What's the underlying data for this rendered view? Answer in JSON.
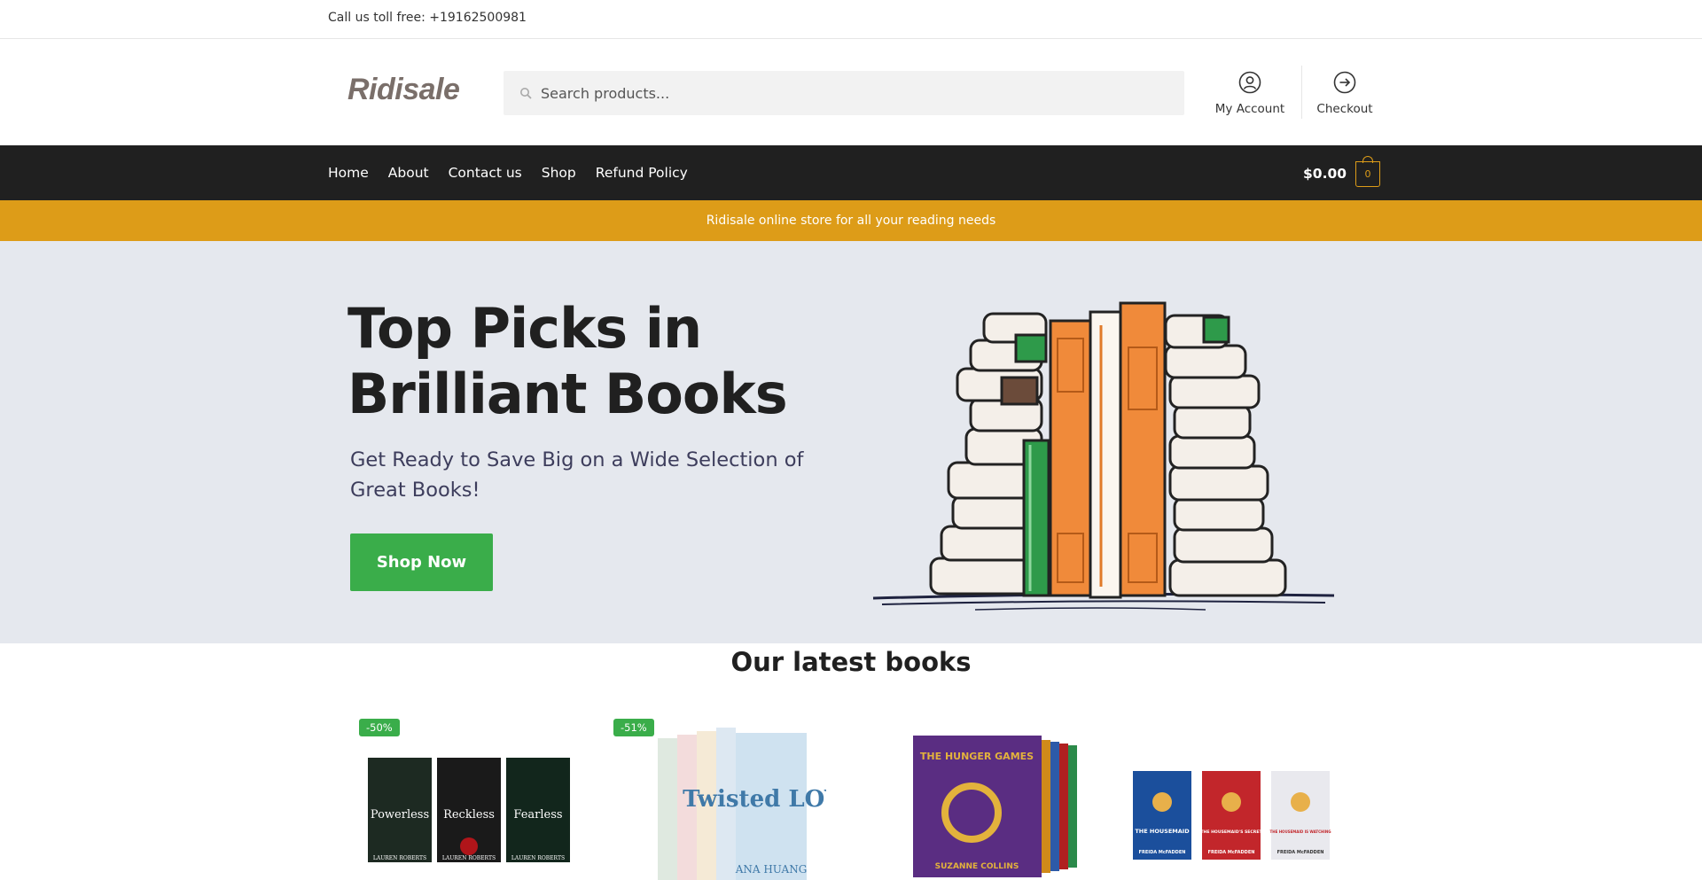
{
  "topbar": {
    "phone": "Call us toll free: +19162500981"
  },
  "header": {
    "logo": "Ridisale",
    "search_placeholder": "Search products...",
    "account_label": "My Account",
    "checkout_label": "Checkout"
  },
  "nav": {
    "items": [
      "Home",
      "About",
      "Contact us",
      "Shop",
      "Refund Policy"
    ],
    "cart_total": "$0.00",
    "cart_count": "0"
  },
  "promo": {
    "text": "Ridisale online store for all your reading needs"
  },
  "hero": {
    "title": "Top Picks in Brilliant Books",
    "subtitle": "Get Ready to Save Big on a Wide Selection of Great Books!",
    "cta": "Shop Now"
  },
  "latest": {
    "title": "Our latest books",
    "products": [
      {
        "badge": "-50%",
        "cover_titles": [
          "Powerless",
          "Reckless",
          "Fearless"
        ],
        "author": "LAUREN ROBERTS"
      },
      {
        "badge": "-51%",
        "cover_titles": [
          "Twisted LOVE"
        ],
        "author": "ANA HUANG"
      },
      {
        "badge": "",
        "cover_titles": [
          "THE HUNGER GAMES"
        ],
        "author": "SUZANNE COLLINS"
      },
      {
        "badge": "",
        "cover_titles": [
          "THE HOUSEMAID",
          "THE HOUSEMAID'S SECRET",
          "THE HOUSEMAID IS WATCHING"
        ],
        "author": "FREIDA McFADDEN"
      }
    ]
  },
  "colors": {
    "accent": "#dd9c18",
    "green": "#3aad4a",
    "nav_bg": "#202020",
    "hero_bg": "#e5e8ee"
  }
}
